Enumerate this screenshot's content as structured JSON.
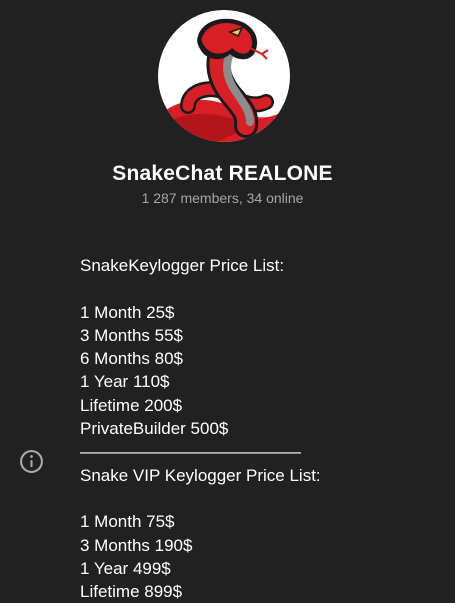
{
  "channel": {
    "title": "SnakeChat REALONE",
    "subtitle": "1 287 members, 34 online"
  },
  "avatar": {
    "icon": "snake-logo",
    "colors": {
      "background": "#ffffff",
      "snake_red": "#d81f26",
      "snake_dark": "#1a1a1a",
      "belly_gray": "#8c8c8c"
    }
  },
  "info": {
    "icon": "info-icon",
    "lines": [
      "SnakeKeylogger Price List:",
      "",
      "1 Month 25$",
      "3 Months 55$",
      "6 Months 80$",
      "1 Year 110$",
      "Lifetime 200$",
      "PrivateBuilder 500$",
      "—————————————",
      "Snake VIP Keylogger Price List:",
      "",
      "1 Month 75$",
      "3 Months 190$",
      "1 Year 499$",
      "Lifetime 899$"
    ]
  },
  "theme": {
    "background": "#212121",
    "text": "#ffffff",
    "muted": "#a6a6a6",
    "icon": "#aaaaaa"
  }
}
